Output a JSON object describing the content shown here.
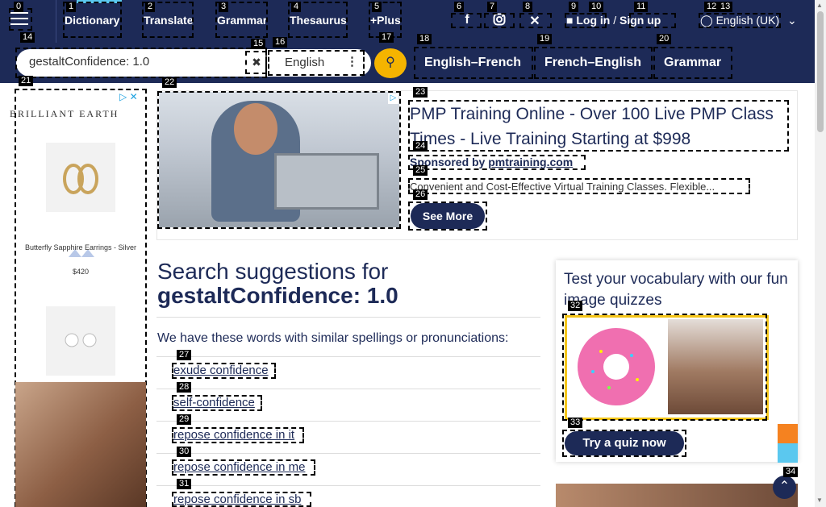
{
  "header": {
    "nav": [
      "Dictionary",
      "Translate",
      "Grammar",
      "Thesaurus",
      "+Plus"
    ],
    "login": "Log in",
    "separator": "/",
    "signup": "Sign up",
    "language": "English (UK)",
    "social": [
      "facebook-icon",
      "instagram-icon",
      "x-twitter-icon"
    ]
  },
  "search": {
    "value": "gestaltConfidence: 1.0",
    "dictionary_select": "English",
    "links": [
      "English–French",
      "French–English",
      "Grammar"
    ]
  },
  "left_ad": {
    "brand": "BRILLIANT EARTH",
    "caption": "Butterfly Sapphire Earrings - Silver",
    "price": "$420"
  },
  "top_ad": {
    "title": "PMP Training Online - Over 100 Live PMP Class Times - Live Training Starting at $998",
    "sponsor_prefix": "Sponsored by",
    "sponsor_domain": "pmtraining.com",
    "description": "Convenient and Cost-Effective Virtual Training Classes. Flexible...",
    "cta": "See More"
  },
  "main": {
    "heading_prefix": "Search suggestions for",
    "heading_query": "gestaltConfidence: 1.0",
    "intro": "We have these words with similar spellings or pronunciations:",
    "suggestions": [
      "exude confidence",
      "self-confidence",
      "repose confidence in it",
      "repose confidence in me",
      "repose confidence in sb"
    ]
  },
  "quiz": {
    "title": "Test your vocabulary with our fun image quizzes",
    "button": "Try a quiz now"
  },
  "badges": [
    "0",
    "1",
    "2",
    "3",
    "4",
    "5",
    "6",
    "7",
    "8",
    "9",
    "10",
    "11",
    "12",
    "13",
    "14",
    "15",
    "16",
    "17",
    "18",
    "19",
    "20",
    "21",
    "22",
    "23",
    "24",
    "25",
    "26",
    "27",
    "28",
    "29",
    "30",
    "31",
    "32",
    "33",
    "34"
  ],
  "colors": {
    "navy": "#1d2a57",
    "accent": "#f5b400",
    "cyan": "#5bc8ef"
  }
}
